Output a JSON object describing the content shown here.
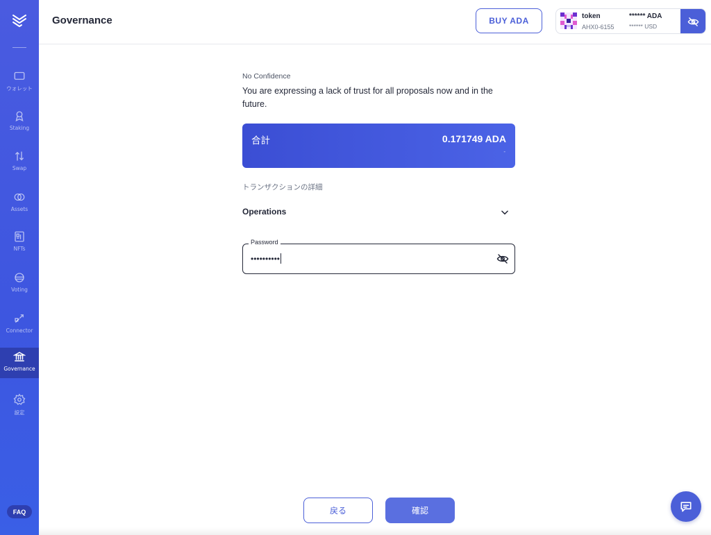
{
  "sidebar": {
    "items": [
      {
        "label": "ウォレット",
        "icon": "wallet-icon"
      },
      {
        "label": "Staking",
        "icon": "staking-icon"
      },
      {
        "label": "Swap",
        "icon": "swap-icon"
      },
      {
        "label": "Assets",
        "icon": "assets-icon"
      },
      {
        "label": "NFTs",
        "icon": "nfts-icon"
      },
      {
        "label": "Voting",
        "icon": "voting-icon"
      },
      {
        "label": "Connector",
        "icon": "connector-icon"
      },
      {
        "label": "Governance",
        "icon": "governance-icon",
        "active": true
      },
      {
        "label": "設定",
        "icon": "settings-icon"
      }
    ],
    "faq_label": "FAQ"
  },
  "header": {
    "title": "Governance",
    "buy_label": "BUY ADA",
    "wallet": {
      "name": "token",
      "id": "AHX0-6155",
      "balance": "****** ADA",
      "usd": "****** USD"
    }
  },
  "main": {
    "vote_type": "No Confidence",
    "vote_description": "You are expressing a lack of trust for all proposals now and in the future.",
    "total": {
      "label": "合計",
      "value": "0.171749 ADA",
      "sub": "-"
    },
    "tx_details_label": "トランザクションの詳細",
    "operations_label": "Operations",
    "password": {
      "label": "Password",
      "value": "••••••••••"
    }
  },
  "footer": {
    "back_label": "戻る",
    "confirm_label": "確認"
  },
  "colors": {
    "accent": "#4b5fd8",
    "sidebar": "#3d56e0",
    "sidebar_active": "#2e3fb0",
    "text": "#242838"
  }
}
